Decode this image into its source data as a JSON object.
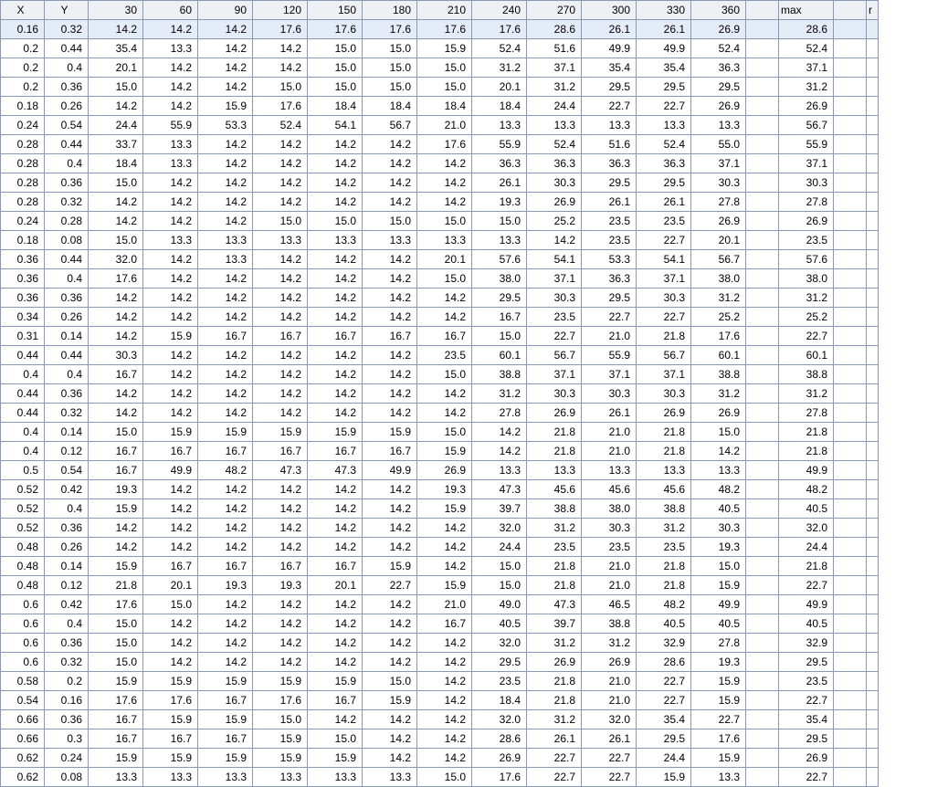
{
  "headers": {
    "x": "X",
    "y": "Y",
    "cols": [
      "30",
      "60",
      "90",
      "120",
      "150",
      "180",
      "210",
      "240",
      "270",
      "300",
      "330",
      "360"
    ],
    "max": "max",
    "tail": "r"
  },
  "rows": [
    {
      "x": "0.16",
      "y": "0.32",
      "v": [
        "14.2",
        "14.2",
        "14.2",
        "17.6",
        "17.6",
        "17.6",
        "17.6",
        "17.6",
        "28.6",
        "26.1",
        "26.1",
        "26.9"
      ],
      "max": "28.6"
    },
    {
      "x": "0.2",
      "y": "0.44",
      "v": [
        "35.4",
        "13.3",
        "14.2",
        "14.2",
        "15.0",
        "15.0",
        "15.9",
        "52.4",
        "51.6",
        "49.9",
        "49.9",
        "52.4"
      ],
      "max": "52.4"
    },
    {
      "x": "0.2",
      "y": "0.4",
      "v": [
        "20.1",
        "14.2",
        "14.2",
        "14.2",
        "15.0",
        "15.0",
        "15.0",
        "31.2",
        "37.1",
        "35.4",
        "35.4",
        "36.3"
      ],
      "max": "37.1"
    },
    {
      "x": "0.2",
      "y": "0.36",
      "v": [
        "15.0",
        "14.2",
        "14.2",
        "15.0",
        "15.0",
        "15.0",
        "15.0",
        "20.1",
        "31.2",
        "29.5",
        "29.5",
        "29.5"
      ],
      "max": "31.2"
    },
    {
      "x": "0.18",
      "y": "0.26",
      "v": [
        "14.2",
        "14.2",
        "15.9",
        "17.6",
        "18.4",
        "18.4",
        "18.4",
        "18.4",
        "24.4",
        "22.7",
        "22.7",
        "26.9"
      ],
      "max": "26.9"
    },
    {
      "x": "0.24",
      "y": "0.54",
      "v": [
        "24.4",
        "55.9",
        "53.3",
        "52.4",
        "54.1",
        "56.7",
        "21.0",
        "13.3",
        "13.3",
        "13.3",
        "13.3",
        "13.3"
      ],
      "max": "56.7"
    },
    {
      "x": "0.28",
      "y": "0.44",
      "v": [
        "33.7",
        "13.3",
        "14.2",
        "14.2",
        "14.2",
        "14.2",
        "17.6",
        "55.9",
        "52.4",
        "51.6",
        "52.4",
        "55.0"
      ],
      "max": "55.9"
    },
    {
      "x": "0.28",
      "y": "0.4",
      "v": [
        "18.4",
        "13.3",
        "14.2",
        "14.2",
        "14.2",
        "14.2",
        "14.2",
        "36.3",
        "36.3",
        "36.3",
        "36.3",
        "37.1"
      ],
      "max": "37.1"
    },
    {
      "x": "0.28",
      "y": "0.36",
      "v": [
        "15.0",
        "14.2",
        "14.2",
        "14.2",
        "14.2",
        "14.2",
        "14.2",
        "26.1",
        "30.3",
        "29.5",
        "29.5",
        "30.3"
      ],
      "max": "30.3"
    },
    {
      "x": "0.28",
      "y": "0.32",
      "v": [
        "14.2",
        "14.2",
        "14.2",
        "14.2",
        "14.2",
        "14.2",
        "14.2",
        "19.3",
        "26.9",
        "26.1",
        "26.1",
        "27.8"
      ],
      "max": "27.8"
    },
    {
      "x": "0.24",
      "y": "0.28",
      "v": [
        "14.2",
        "14.2",
        "14.2",
        "15.0",
        "15.0",
        "15.0",
        "15.0",
        "15.0",
        "25.2",
        "23.5",
        "23.5",
        "26.9"
      ],
      "max": "26.9"
    },
    {
      "x": "0.18",
      "y": "0.08",
      "v": [
        "15.0",
        "13.3",
        "13.3",
        "13.3",
        "13.3",
        "13.3",
        "13.3",
        "13.3",
        "14.2",
        "23.5",
        "22.7",
        "20.1"
      ],
      "max": "23.5"
    },
    {
      "x": "0.36",
      "y": "0.44",
      "v": [
        "32.0",
        "14.2",
        "13.3",
        "14.2",
        "14.2",
        "14.2",
        "20.1",
        "57.6",
        "54.1",
        "53.3",
        "54.1",
        "56.7"
      ],
      "max": "57.6"
    },
    {
      "x": "0.36",
      "y": "0.4",
      "v": [
        "17.6",
        "14.2",
        "14.2",
        "14.2",
        "14.2",
        "14.2",
        "15.0",
        "38.0",
        "37.1",
        "36.3",
        "37.1",
        "38.0"
      ],
      "max": "38.0"
    },
    {
      "x": "0.36",
      "y": "0.36",
      "v": [
        "14.2",
        "14.2",
        "14.2",
        "14.2",
        "14.2",
        "14.2",
        "14.2",
        "29.5",
        "30.3",
        "29.5",
        "30.3",
        "31.2"
      ],
      "max": "31.2"
    },
    {
      "x": "0.34",
      "y": "0.26",
      "v": [
        "14.2",
        "14.2",
        "14.2",
        "14.2",
        "14.2",
        "14.2",
        "14.2",
        "16.7",
        "23.5",
        "22.7",
        "22.7",
        "25.2"
      ],
      "max": "25.2"
    },
    {
      "x": "0.31",
      "y": "0.14",
      "v": [
        "14.2",
        "15.9",
        "16.7",
        "16.7",
        "16.7",
        "16.7",
        "16.7",
        "15.0",
        "22.7",
        "21.0",
        "21.8",
        "17.6"
      ],
      "max": "22.7"
    },
    {
      "x": "0.44",
      "y": "0.44",
      "v": [
        "30.3",
        "14.2",
        "14.2",
        "14.2",
        "14.2",
        "14.2",
        "23.5",
        "60.1",
        "56.7",
        "55.9",
        "56.7",
        "60.1"
      ],
      "max": "60.1"
    },
    {
      "x": "0.4",
      "y": "0.4",
      "v": [
        "16.7",
        "14.2",
        "14.2",
        "14.2",
        "14.2",
        "14.2",
        "15.0",
        "38.8",
        "37.1",
        "37.1",
        "37.1",
        "38.8"
      ],
      "max": "38.8"
    },
    {
      "x": "0.44",
      "y": "0.36",
      "v": [
        "14.2",
        "14.2",
        "14.2",
        "14.2",
        "14.2",
        "14.2",
        "14.2",
        "31.2",
        "30.3",
        "30.3",
        "30.3",
        "31.2"
      ],
      "max": "31.2"
    },
    {
      "x": "0.44",
      "y": "0.32",
      "v": [
        "14.2",
        "14.2",
        "14.2",
        "14.2",
        "14.2",
        "14.2",
        "14.2",
        "27.8",
        "26.9",
        "26.1",
        "26.9",
        "26.9"
      ],
      "max": "27.8"
    },
    {
      "x": "0.4",
      "y": "0.14",
      "v": [
        "15.0",
        "15.9",
        "15.9",
        "15.9",
        "15.9",
        "15.9",
        "15.0",
        "14.2",
        "21.8",
        "21.0",
        "21.8",
        "15.0"
      ],
      "max": "21.8"
    },
    {
      "x": "0.4",
      "y": "0.12",
      "v": [
        "16.7",
        "16.7",
        "16.7",
        "16.7",
        "16.7",
        "16.7",
        "15.9",
        "14.2",
        "21.8",
        "21.0",
        "21.8",
        "14.2"
      ],
      "max": "21.8"
    },
    {
      "x": "0.5",
      "y": "0.54",
      "v": [
        "16.7",
        "49.9",
        "48.2",
        "47.3",
        "47.3",
        "49.9",
        "26.9",
        "13.3",
        "13.3",
        "13.3",
        "13.3",
        "13.3"
      ],
      "max": "49.9"
    },
    {
      "x": "0.52",
      "y": "0.42",
      "v": [
        "19.3",
        "14.2",
        "14.2",
        "14.2",
        "14.2",
        "14.2",
        "19.3",
        "47.3",
        "45.6",
        "45.6",
        "45.6",
        "48.2"
      ],
      "max": "48.2"
    },
    {
      "x": "0.52",
      "y": "0.4",
      "v": [
        "15.9",
        "14.2",
        "14.2",
        "14.2",
        "14.2",
        "14.2",
        "15.9",
        "39.7",
        "38.8",
        "38.0",
        "38.8",
        "40.5"
      ],
      "max": "40.5"
    },
    {
      "x": "0.52",
      "y": "0.36",
      "v": [
        "14.2",
        "14.2",
        "14.2",
        "14.2",
        "14.2",
        "14.2",
        "14.2",
        "32.0",
        "31.2",
        "30.3",
        "31.2",
        "30.3"
      ],
      "max": "32.0"
    },
    {
      "x": "0.48",
      "y": "0.26",
      "v": [
        "14.2",
        "14.2",
        "14.2",
        "14.2",
        "14.2",
        "14.2",
        "14.2",
        "24.4",
        "23.5",
        "23.5",
        "23.5",
        "19.3"
      ],
      "max": "24.4"
    },
    {
      "x": "0.48",
      "y": "0.14",
      "v": [
        "15.9",
        "16.7",
        "16.7",
        "16.7",
        "16.7",
        "15.9",
        "14.2",
        "15.0",
        "21.8",
        "21.0",
        "21.8",
        "15.0"
      ],
      "max": "21.8"
    },
    {
      "x": "0.48",
      "y": "0.12",
      "v": [
        "21.8",
        "20.1",
        "19.3",
        "19.3",
        "20.1",
        "22.7",
        "15.9",
        "15.0",
        "21.8",
        "21.0",
        "21.8",
        "15.9"
      ],
      "max": "22.7"
    },
    {
      "x": "0.6",
      "y": "0.42",
      "v": [
        "17.6",
        "15.0",
        "14.2",
        "14.2",
        "14.2",
        "14.2",
        "21.0",
        "49.0",
        "47.3",
        "46.5",
        "48.2",
        "49.9"
      ],
      "max": "49.9"
    },
    {
      "x": "0.6",
      "y": "0.4",
      "v": [
        "15.0",
        "14.2",
        "14.2",
        "14.2",
        "14.2",
        "14.2",
        "16.7",
        "40.5",
        "39.7",
        "38.8",
        "40.5",
        "40.5"
      ],
      "max": "40.5"
    },
    {
      "x": "0.6",
      "y": "0.36",
      "v": [
        "15.0",
        "14.2",
        "14.2",
        "14.2",
        "14.2",
        "14.2",
        "14.2",
        "32.0",
        "31.2",
        "31.2",
        "32.9",
        "27.8"
      ],
      "max": "32.9"
    },
    {
      "x": "0.6",
      "y": "0.32",
      "v": [
        "15.0",
        "14.2",
        "14.2",
        "14.2",
        "14.2",
        "14.2",
        "14.2",
        "29.5",
        "26.9",
        "26.9",
        "28.6",
        "19.3"
      ],
      "max": "29.5"
    },
    {
      "x": "0.58",
      "y": "0.2",
      "v": [
        "15.9",
        "15.9",
        "15.9",
        "15.9",
        "15.9",
        "15.0",
        "14.2",
        "23.5",
        "21.8",
        "21.0",
        "22.7",
        "15.9"
      ],
      "max": "23.5"
    },
    {
      "x": "0.54",
      "y": "0.16",
      "v": [
        "17.6",
        "17.6",
        "16.7",
        "17.6",
        "16.7",
        "15.9",
        "14.2",
        "18.4",
        "21.8",
        "21.0",
        "22.7",
        "15.9"
      ],
      "max": "22.7"
    },
    {
      "x": "0.66",
      "y": "0.36",
      "v": [
        "16.7",
        "15.9",
        "15.9",
        "15.0",
        "14.2",
        "14.2",
        "14.2",
        "32.0",
        "31.2",
        "32.0",
        "35.4",
        "22.7"
      ],
      "max": "35.4"
    },
    {
      "x": "0.66",
      "y": "0.3",
      "v": [
        "16.7",
        "16.7",
        "16.7",
        "15.9",
        "15.0",
        "14.2",
        "14.2",
        "28.6",
        "26.1",
        "26.1",
        "29.5",
        "17.6"
      ],
      "max": "29.5"
    },
    {
      "x": "0.62",
      "y": "0.24",
      "v": [
        "15.9",
        "15.9",
        "15.9",
        "15.9",
        "15.9",
        "14.2",
        "14.2",
        "26.9",
        "22.7",
        "22.7",
        "24.4",
        "15.9"
      ],
      "max": "26.9"
    },
    {
      "x": "0.62",
      "y": "0.08",
      "v": [
        "13.3",
        "13.3",
        "13.3",
        "13.3",
        "13.3",
        "13.3",
        "15.0",
        "17.6",
        "22.7",
        "22.7",
        "15.9",
        "13.3"
      ],
      "max": "22.7"
    }
  ]
}
